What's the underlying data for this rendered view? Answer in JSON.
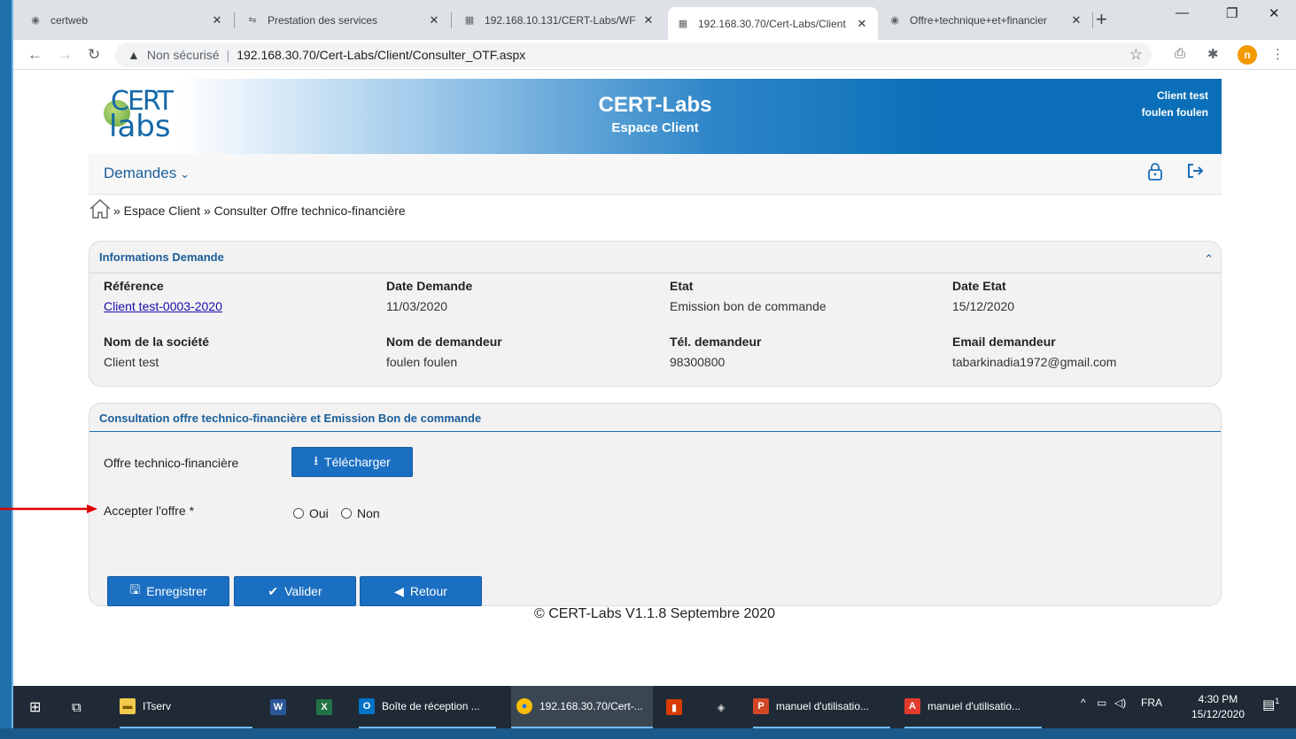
{
  "browser": {
    "tabs": [
      {
        "title": "certweb",
        "active": false
      },
      {
        "title": "Prestation des services",
        "active": false
      },
      {
        "title": "192.168.10.131/CERT-Labs/WF",
        "active": false
      },
      {
        "title": "192.168.30.70/Cert-Labs/Client",
        "active": true
      },
      {
        "title": "Offre+technique+et+financier",
        "active": false
      }
    ],
    "security_label": "Non sécurisé",
    "url": "192.168.30.70/Cert-Labs/Client/Consulter_OTF.aspx",
    "profile_initial": "n"
  },
  "header": {
    "logo_top": "CERT",
    "logo_bottom": "labs",
    "title": "CERT-Labs",
    "subtitle": "Espace Client",
    "user_line1": "Client test",
    "user_line2": "foulen foulen"
  },
  "menu": {
    "demandes_label": "Demandes"
  },
  "breadcrumb": {
    "text": "» Espace Client » Consulter Offre technico-financière"
  },
  "info_panel": {
    "title": "Informations Demande",
    "reference_label": "Référence",
    "reference_value": "Client test-0003-2020",
    "date_demande_label": "Date Demande",
    "date_demande_value": "11/03/2020",
    "etat_label": "Etat",
    "etat_value": "Emission bon de commande",
    "date_etat_label": "Date Etat",
    "date_etat_value": "15/12/2020",
    "societe_label": "Nom de la société",
    "societe_value": "Client test",
    "demandeur_label": "Nom de demandeur",
    "demandeur_value": "foulen foulen",
    "tel_label": "Tél. demandeur",
    "tel_value": "98300800",
    "email_label": "Email demandeur",
    "email_value": "tabarkinadia1972@gmail.com"
  },
  "offer_panel": {
    "title": "Consultation offre technico-financière et Emission Bon de commande",
    "offre_label": "Offre technico-financière",
    "download_label": "Télécharger",
    "accept_label": "Accepter l'offre *",
    "oui_label": "Oui",
    "non_label": "Non",
    "save_label": "Enregistrer",
    "validate_label": "Valider",
    "back_label": "Retour"
  },
  "footer": {
    "text": "© CERT-Labs V1.1.8 Septembre 2020"
  },
  "taskbar": {
    "items": [
      {
        "label": "ITserv"
      },
      {
        "label": "Boîte de réception ..."
      },
      {
        "label": "192.168.30.70/Cert-..."
      },
      {
        "label": "manuel d'utilisatio..."
      },
      {
        "label": "manuel d'utilisatio..."
      }
    ],
    "language": "FRA",
    "time": "4:30 PM",
    "date": "15/12/2020",
    "notification_count": "1"
  },
  "colors": {
    "primary": "#1b6fc2",
    "header_blue": "#0a6fb8",
    "link_blue": "#1a5d99",
    "arrow_red": "#e00000"
  }
}
